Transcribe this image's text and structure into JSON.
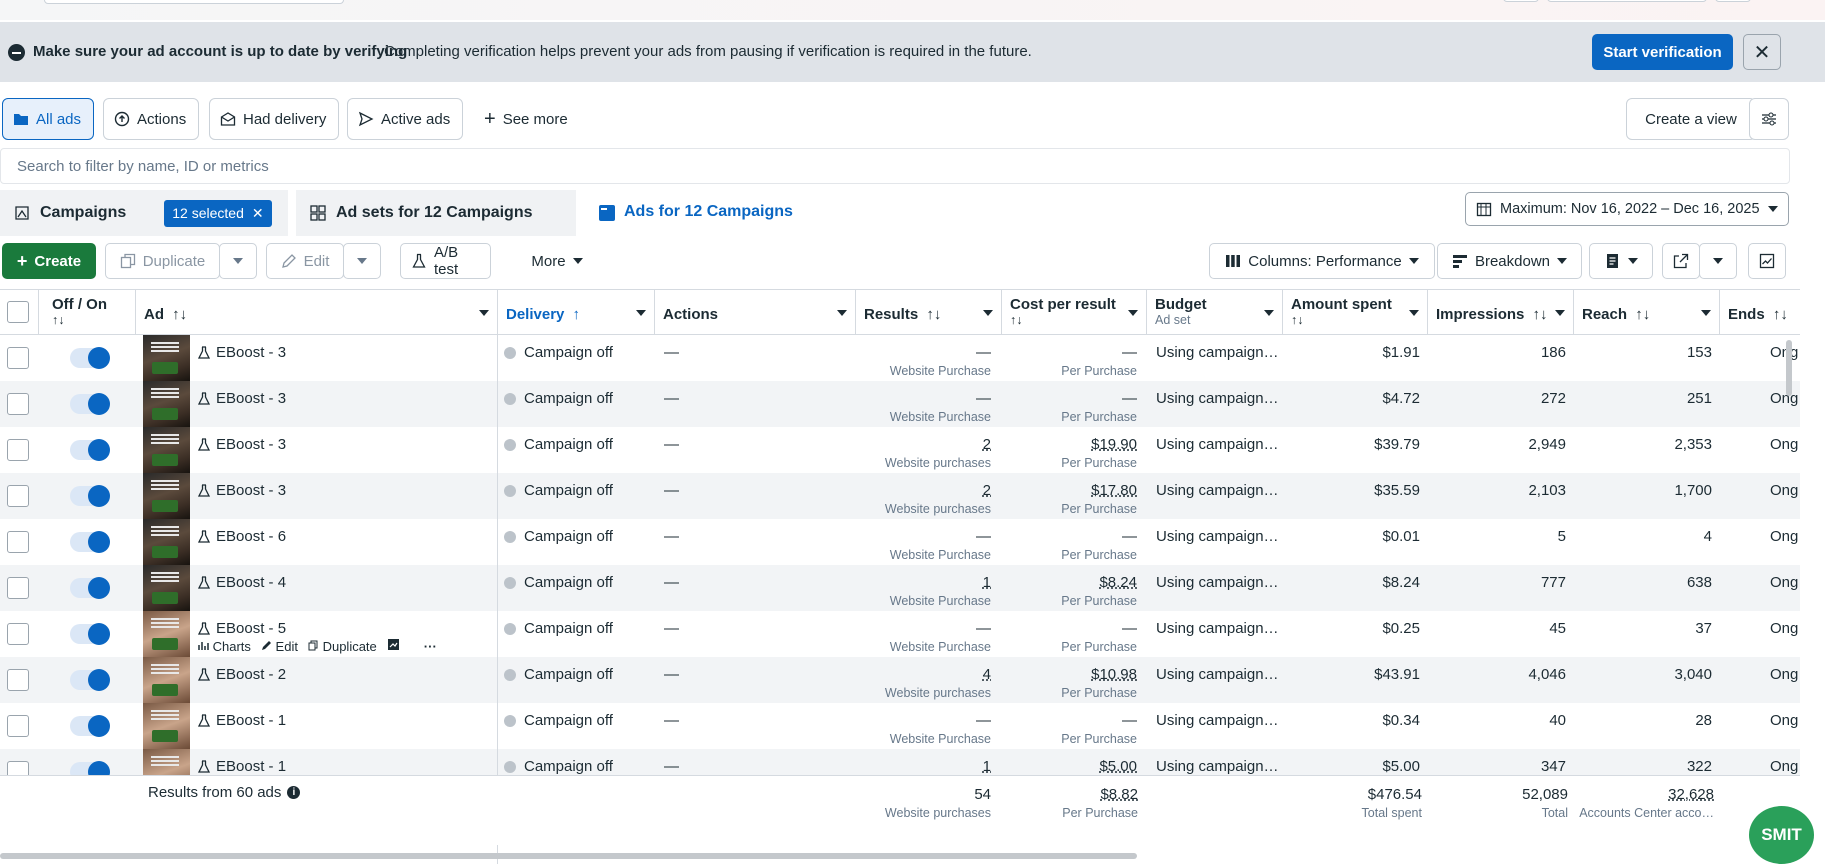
{
  "banner": {
    "title": "Make sure your ad account is up to date by verifying",
    "text": "Completing verification helps prevent your ads from pausing if verification is required in the future.",
    "button": "Start verification",
    "close": "✕"
  },
  "filters": {
    "all_ads": "All ads",
    "actions": "Actions",
    "had_delivery": "Had delivery",
    "active_ads": "Active ads",
    "see_more": "See more",
    "create_view": "Create a view"
  },
  "search": {
    "placeholder": "Search to filter by name, ID or metrics"
  },
  "tabs": {
    "campaigns": "Campaigns",
    "selected_chip": "12 selected",
    "ad_sets": "Ad sets for 12 Campaigns",
    "ads": "Ads for 12 Campaigns",
    "date_range": "Maximum: Nov 16, 2022 – Dec 16, 2025"
  },
  "toolbar": {
    "create": "Create",
    "duplicate": "Duplicate",
    "edit": "Edit",
    "ab_test": "A/B test",
    "more": "More",
    "columns": "Columns: Performance",
    "breakdown": "Breakdown"
  },
  "columns": {
    "off_on": "Off / On",
    "sort_glyph": "↑↓",
    "ad": "Ad",
    "delivery": "Delivery",
    "delivery_sort": "↑",
    "actions": "Actions",
    "results": "Results",
    "cost_per_result": "Cost per result",
    "budget": "Budget",
    "budget_sub": "Ad set",
    "amount_spent": "Amount spent",
    "impressions": "Impressions",
    "reach": "Reach",
    "ends": "Ends"
  },
  "rows": [
    {
      "name": "EBoost - 3",
      "delivery": "Campaign off",
      "actions": "—",
      "results": "—",
      "results_sub": "Website Purchase",
      "cost": "—",
      "cost_sub": "Per Purchase",
      "budget": "Using campaign…",
      "spent": "$1.91",
      "impressions": "186",
      "reach": "153",
      "ends": "Ong"
    },
    {
      "name": "EBoost - 3",
      "delivery": "Campaign off",
      "actions": "—",
      "results": "—",
      "results_sub": "Website Purchase",
      "cost": "—",
      "cost_sub": "Per Purchase",
      "budget": "Using campaign…",
      "spent": "$4.72",
      "impressions": "272",
      "reach": "251",
      "ends": "Ong"
    },
    {
      "name": "EBoost - 3",
      "delivery": "Campaign off",
      "actions": "—",
      "results": "2",
      "results_sub": "Website purchases",
      "cost": "$19.90",
      "cost_sub": "Per Purchase",
      "budget": "Using campaign…",
      "spent": "$39.79",
      "impressions": "2,949",
      "reach": "2,353",
      "ends": "Ong"
    },
    {
      "name": "EBoost - 3",
      "delivery": "Campaign off",
      "actions": "—",
      "results": "2",
      "results_sub": "Website purchases",
      "cost": "$17.80",
      "cost_sub": "Per Purchase",
      "budget": "Using campaign…",
      "spent": "$35.59",
      "impressions": "2,103",
      "reach": "1,700",
      "ends": "Ong"
    },
    {
      "name": "EBoost - 6",
      "delivery": "Campaign off",
      "actions": "—",
      "results": "—",
      "results_sub": "Website Purchase",
      "cost": "—",
      "cost_sub": "Per Purchase",
      "budget": "Using campaign…",
      "spent": "$0.01",
      "impressions": "5",
      "reach": "4",
      "ends": "Ong"
    },
    {
      "name": "EBoost - 4",
      "delivery": "Campaign off",
      "actions": "—",
      "results": "1",
      "results_sub": "Website Purchase",
      "cost": "$8.24",
      "cost_sub": "Per Purchase",
      "budget": "Using campaign…",
      "spent": "$8.24",
      "impressions": "777",
      "reach": "638",
      "ends": "Ong"
    },
    {
      "name": "EBoost - 5",
      "delivery": "Campaign off",
      "actions": "—",
      "results": "—",
      "results_sub": "Website Purchase",
      "cost": "—",
      "cost_sub": "Per Purchase",
      "budget": "Using campaign…",
      "spent": "$0.25",
      "impressions": "45",
      "reach": "37",
      "ends": "Ong"
    },
    {
      "name": "EBoost - 2",
      "delivery": "Campaign off",
      "actions": "—",
      "results": "4",
      "results_sub": "Website purchases",
      "cost": "$10.98",
      "cost_sub": "Per Purchase",
      "budget": "Using campaign…",
      "spent": "$43.91",
      "impressions": "4,046",
      "reach": "3,040",
      "ends": "Ong"
    },
    {
      "name": "EBoost - 1",
      "delivery": "Campaign off",
      "actions": "—",
      "results": "—",
      "results_sub": "Website Purchase",
      "cost": "—",
      "cost_sub": "Per Purchase",
      "budget": "Using campaign…",
      "spent": "$0.34",
      "impressions": "40",
      "reach": "28",
      "ends": "Ong"
    },
    {
      "name": "EBoost - 1",
      "delivery": "Campaign off",
      "actions": "—",
      "results": "1",
      "results_sub": "",
      "cost": "$5.00",
      "cost_sub": "",
      "budget": "Using campaign…",
      "spent": "$5.00",
      "impressions": "347",
      "reach": "322",
      "ends": "Ong"
    }
  ],
  "hover_actions": {
    "charts": "Charts",
    "edit": "Edit",
    "duplicate": "Duplicate",
    "more": "···"
  },
  "footer": {
    "label": "Results from 60 ads",
    "results": "54",
    "results_sub": "Website purchases",
    "cost": "$8.82",
    "cost_sub": "Per Purchase",
    "spent": "$476.54",
    "spent_sub": "Total spent",
    "impressions": "52,089",
    "impressions_sub": "Total",
    "reach": "32,628",
    "reach_sub": "Accounts Center acco…"
  },
  "smit_badge": "SMIT"
}
